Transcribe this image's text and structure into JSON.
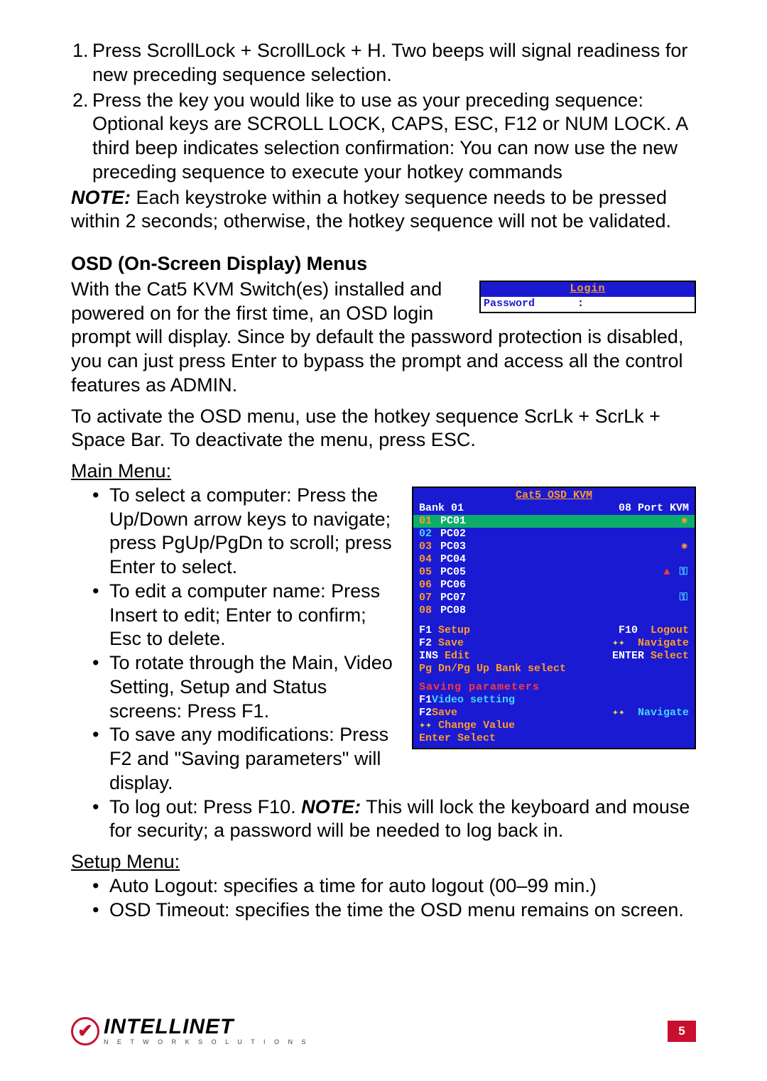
{
  "steps": {
    "s1_num": "1.",
    "s1": "Press ScrollLock + ScrollLock + H. Two beeps will signal readiness for new preceding sequence selection.",
    "s2_num": "2.",
    "s2": "Press the key you would like to use as your preceding sequence: Optional keys are SCROLL LOCK, CAPS, ESC, F12 or NUM LOCK. A third beep indicates selection confirmation: You can now use the new preceding sequence to execute your hotkey commands"
  },
  "note1_label": "NOTE:",
  "note1": " Each keystroke within a hotkey sequence needs to be pressed within 2 seconds; otherwise, the hotkey sequence will not be validated.",
  "heading": "OSD (On-Screen Display) Menus",
  "para1": "With the Cat5 KVM Switch(es) installed and powered on for the first time, an OSD login prompt will display. Since by default the password protection is disabled, you can just press Enter to bypass the prompt and access all the control features as ADMIN.",
  "para2": "To activate the OSD menu, use the hotkey sequence ScrLk + ScrLk + Space Bar. To deactivate the menu, press ESC.",
  "osd_login": {
    "title": "Login",
    "pw_label": "Password",
    "cursor": ":"
  },
  "main_menu_label": "Main Menu:",
  "main_bullets": {
    "b1": "To select a computer: Press the Up/Down arrow keys to navigate; press PgUp/PgDn to scroll; press Enter to select.",
    "b2": "To edit a computer name: Press Insert to edit; Enter to confirm; Esc to delete.",
    "b3": "To rotate through the Main, Video Setting, Setup and Status screens: Press F1.",
    "b4": "To save any modifications: Press F2 and \"Saving parameters\" will display.",
    "b5a": "To log out: Press F10. ",
    "b5_note": "NOTE:",
    "b5b": " This will lock the keyboard and mouse for security; a password will be needed to log back in."
  },
  "osd_main": {
    "title": "Cat5 OSD KVM",
    "bank": "Bank 01",
    "portinfo": "08 Port KVM",
    "rows": [
      {
        "idx": "01",
        "name": "PC01",
        "sel": true,
        "gear": true
      },
      {
        "idx": "02",
        "name": "PC02",
        "blue": true
      },
      {
        "idx": "03",
        "name": "PC03",
        "gear": true
      },
      {
        "idx": "04",
        "name": "PC04"
      },
      {
        "idx": "05",
        "name": "PC05",
        "person": true,
        "key": true
      },
      {
        "idx": "06",
        "name": "PC06"
      },
      {
        "idx": "07",
        "name": "PC07",
        "key": true
      },
      {
        "idx": "08",
        "name": "PC08"
      }
    ],
    "legend": {
      "f1": "F1",
      "setup": "Setup",
      "f10": "F10",
      "logout": "Logout",
      "f2": "F2",
      "save": "Save",
      "arr": "✦✦",
      "nav": "Navigate",
      "ins": "INS",
      "edit": "Edit",
      "enter": "ENTER",
      "select": "Select",
      "bottom": "Pg Dn/Pg Up Bank select"
    },
    "sub": {
      "saving": "Saving parameters",
      "f1": "F1",
      "video": "Video setting",
      "f2": "F2",
      "save": "Save",
      "arr": "✦✦",
      "nav": "Navigate",
      "chg_a": "✦✦",
      "chg": "Change Value",
      "ent": "Enter Select"
    }
  },
  "setup_menu_label": "Setup Menu:",
  "setup_bullets": {
    "b1": "Auto Logout: specifies a time for auto logout (00–99 min.)",
    "b2": "OSD Timeout: specifies the time the OSD menu remains on screen."
  },
  "footer": {
    "logo_main": "INTELLINET",
    "logo_sub": "N E T W O R K   S O L U T I O N S",
    "check": "✔",
    "page": "5"
  }
}
